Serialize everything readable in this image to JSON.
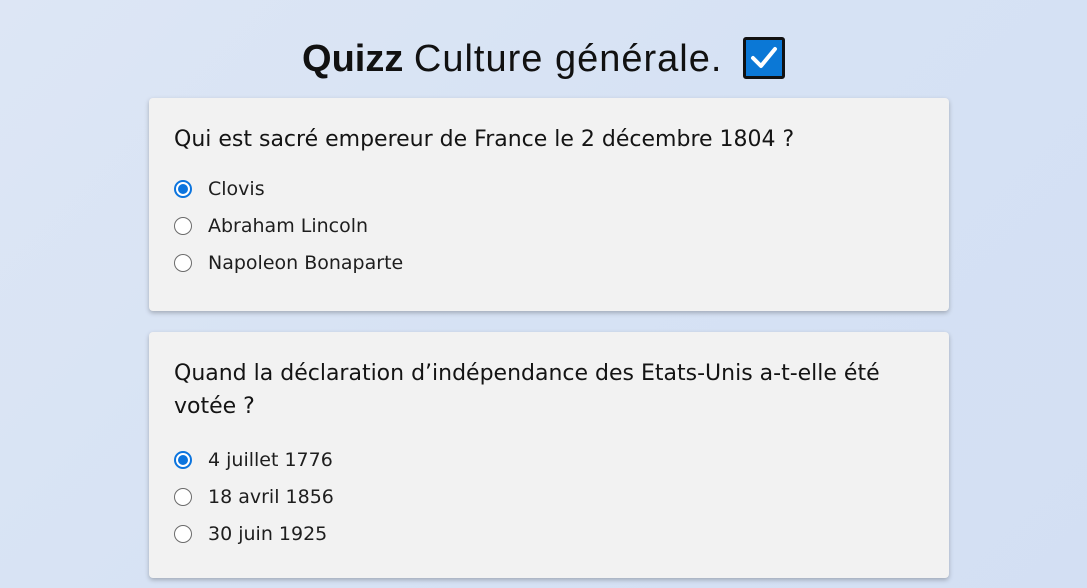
{
  "header": {
    "title_strong": "Quizz",
    "title_rest": "Culture générale.",
    "emoji_icon": "check-mark-button-icon",
    "emoji_color": "#0b78d6"
  },
  "questions": [
    {
      "text": "Qui est sacré empereur de France le 2 décembre 1804 ?",
      "options": [
        {
          "label": "Clovis",
          "checked": true
        },
        {
          "label": "Abraham Lincoln",
          "checked": false
        },
        {
          "label": "Napoleon Bonaparte",
          "checked": false
        }
      ]
    },
    {
      "text": "Quand la déclaration d’indépendance des Etats-Unis a-t-elle été votée ?",
      "options": [
        {
          "label": "4 juillet 1776",
          "checked": true
        },
        {
          "label": "18 avril 1856",
          "checked": false
        },
        {
          "label": "30 juin 1925",
          "checked": false
        }
      ]
    }
  ],
  "colors": {
    "accent": "#0b74de",
    "card_background": "#f2f2f2"
  }
}
